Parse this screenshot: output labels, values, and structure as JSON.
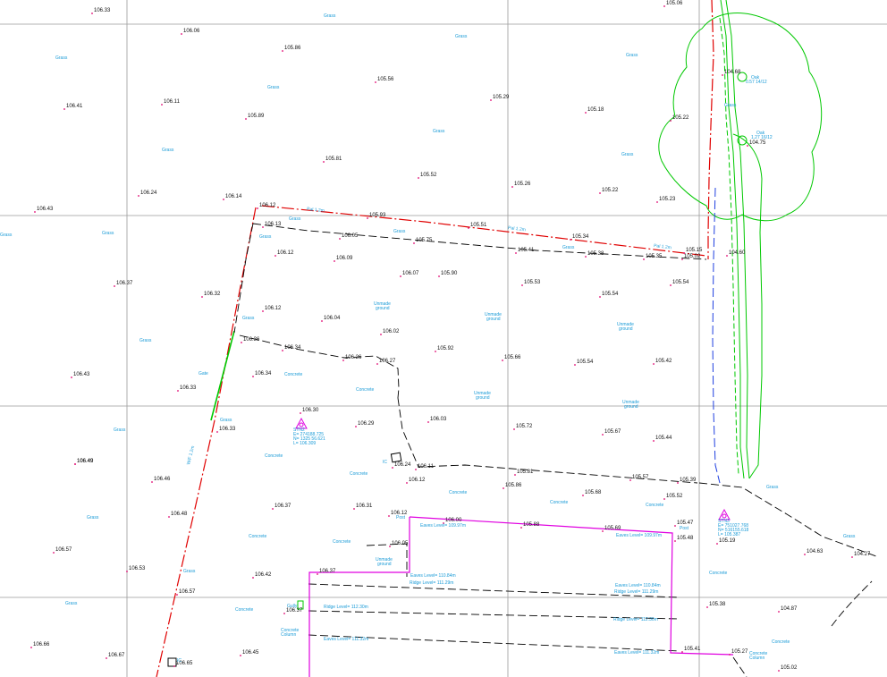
{
  "colors": {
    "grid": "#9a9a9a",
    "boundary_red": "#e00000",
    "dash_black": "#000000",
    "building_magenta": "#e000e0",
    "tree_green": "#00c800",
    "blue_line": "#1f3fe0",
    "label_cyan": "#1a9bd7",
    "spot_level": "#111111"
  },
  "spot_levels": [
    "106.33",
    "106.06",
    "105.86",
    "105.56",
    "105.29",
    "105.18",
    "105.22",
    "105.06",
    "106.41",
    "106.11",
    "105.89",
    "105.81",
    "105.52",
    "105.26",
    "105.22",
    "105.23",
    "106.24",
    "106.14",
    "106.43",
    "106.12",
    "105.93",
    "105.51",
    "105.34",
    "106.13",
    "106.05",
    "105.75",
    "105.41",
    "105.38",
    "105.35",
    "105.02",
    "105.15",
    "106.12",
    "106.09",
    "106.07",
    "105.90",
    "105.53",
    "105.54",
    "105.54",
    "106.37",
    "106.32",
    "106.12",
    "106.04",
    "106.02",
    "104.60",
    "104.68",
    "104.75",
    "106.49",
    "106.36",
    "106.34",
    "106.26",
    "106.27",
    "105.92",
    "105.66",
    "105.54",
    "105.42",
    "106.43",
    "106.34",
    "106.33",
    "106.30",
    "106.29",
    "106.03",
    "105.72",
    "105.67",
    "105.44",
    "106.49",
    "106.46",
    "106.33",
    "106.24",
    "106.11",
    "106.12",
    "105.81",
    "105.86",
    "105.57",
    "106.48",
    "106.37",
    "106.31",
    "106.12",
    "106.00",
    "105.88",
    "105.69",
    "105.68",
    "105.52",
    "105.39",
    "106.57",
    "106.53",
    "106.57",
    "106.42",
    "106.05",
    "105.47",
    "105.48",
    "105.19",
    "104.63",
    "104.27",
    "106.66",
    "106.67",
    "106.65",
    "106.45",
    "106.37",
    "106.37",
    "105.38",
    "104.87",
    "105.41",
    "105.27",
    "105.02"
  ],
  "labels": {
    "grass": "Grass",
    "concrete": "Concrete",
    "unmade_ground": [
      "Unmade",
      "ground"
    ],
    "gate": "Gate",
    "post": "Post",
    "gully": "Gully",
    "ic": "IC",
    "concrete_column": [
      "Concrete",
      "Column"
    ],
    "pal_fence": "Pal 1.2m",
    "wall_fence": "W/F 1.2m"
  },
  "building_annotations": [
    "Eaves Level= 109.97m",
    "Eaves Level= 109.97m",
    "Eaves Level= 110.84m",
    "Ridge Level= 111.29m",
    "Eaves Level= 110.84m",
    "Ridge Level= 111.29m",
    "Ridge Level= 112.30m",
    "Ridge Level= 112.30m",
    "Eaves Level= 111.32m",
    "Eaves Level= 111.32m"
  ],
  "trees": [
    [
      "Oak",
      "0.57 14/12"
    ],
    [
      "Oak",
      "1.27 16/12"
    ]
  ],
  "stations": [
    [
      "STN2",
      "E= 274188.725",
      "N= 1325 56.621",
      "L= 106.309"
    ],
    [
      "STN3",
      "E= 751027.768",
      "N= 516155.618",
      "L= 105.387"
    ]
  ]
}
